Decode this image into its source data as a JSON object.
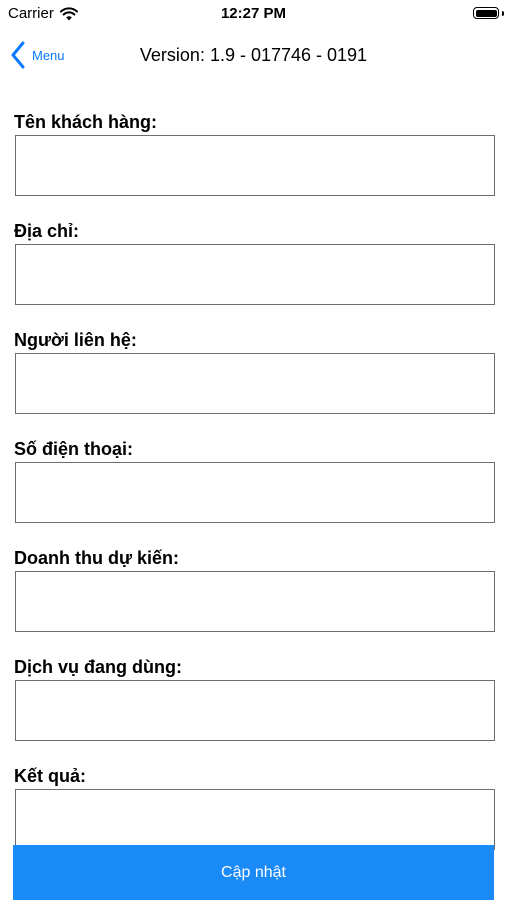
{
  "status_bar": {
    "carrier": "Carrier",
    "time": "12:27 PM",
    "wifi_icon": "wifi-icon",
    "battery_icon": "battery-icon",
    "battery_level": 1.0
  },
  "nav": {
    "back_label": "Menu",
    "back_icon": "chevron-left-icon",
    "title": "Version: 1.9 - 017746 - 0191",
    "accent_color": "#0a7aff"
  },
  "form": {
    "fields": [
      {
        "label": "Tên khách hàng:",
        "value": "",
        "placeholder": ""
      },
      {
        "label": "Địa chỉ:",
        "value": "",
        "placeholder": ""
      },
      {
        "label": "Người liên hệ:",
        "value": "",
        "placeholder": ""
      },
      {
        "label": "Số điện thoại:",
        "value": "",
        "placeholder": ""
      },
      {
        "label": "Doanh thu dự kiến:",
        "value": "",
        "placeholder": ""
      },
      {
        "label": "Dịch vụ đang dùng:",
        "value": "",
        "placeholder": ""
      },
      {
        "label": "Kết quả:",
        "value": "",
        "placeholder": ""
      }
    ]
  },
  "submit": {
    "label": "Cập nhật",
    "color": "#1a8af7"
  }
}
